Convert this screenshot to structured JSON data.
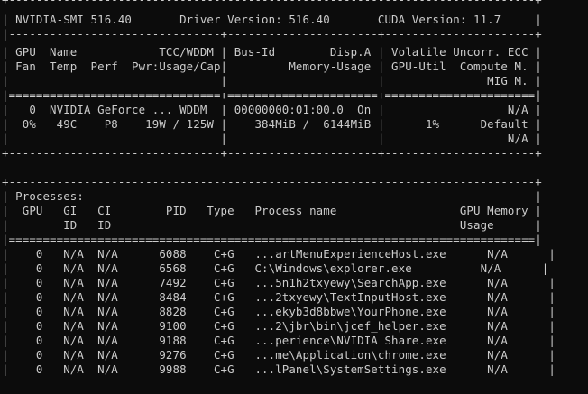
{
  "terminal": {
    "lines": [
      "+-----------------------------------------------------------------------------+",
      "| NVIDIA-SMI 516.40       Driver Version: 516.40       CUDA Version: 11.7     |",
      "|-------------------------------+----------------------+----------------------+",
      "| GPU  Name            TCC/WDDM | Bus-Id        Disp.A | Volatile Uncorr. ECC |",
      "| Fan  Temp  Perf  Pwr:Usage/Cap|         Memory-Usage | GPU-Util  Compute M. |",
      "|                               |                      |               MIG M. |",
      "|===============================+======================+======================|",
      "|   0  NVIDIA GeForce ... WDDM  | 00000000:01:00.0  On |                  N/A |",
      "|  0%   49C    P8    19W / 125W |    384MiB /  6144MiB |      1%      Default |",
      "|                               |                      |                  N/A |",
      "+-------------------------------+----------------------+----------------------+",
      "",
      "+-----------------------------------------------------------------------------+",
      "| Processes:                                                                  |",
      "|  GPU   GI   CI        PID   Type   Process name                  GPU Memory |",
      "|        ID   ID                                                   Usage      |",
      "|=============================================================================|",
      "|    0   N/A  N/A      6088    C+G   ...artMenuExperienceHost.exe      N/A      |",
      "|    0   N/A  N/A      6568    C+G   C:\\Windows\\explorer.exe          N/A      |",
      "|    0   N/A  N/A      7492    C+G   ...5n1h2txyewy\\SearchApp.exe      N/A      |",
      "|    0   N/A  N/A      8484    C+G   ...2txyewy\\TextInputHost.exe      N/A      |",
      "|    0   N/A  N/A      8828    C+G   ...ekyb3d8bbwe\\YourPhone.exe      N/A      |",
      "|    0   N/A  N/A      9100    C+G   ...2\\jbr\\bin\\jcef_helper.exe      N/A      |",
      "|    0   N/A  N/A      9188    C+G   ...perience\\NVIDIA Share.exe      N/A      |",
      "|    0   N/A  N/A      9276    C+G   ...me\\Application\\chrome.exe      N/A      |",
      "|    0   N/A  N/A      9988    C+G   ...lPanel\\SystemSettings.exe      N/A      |"
    ]
  }
}
